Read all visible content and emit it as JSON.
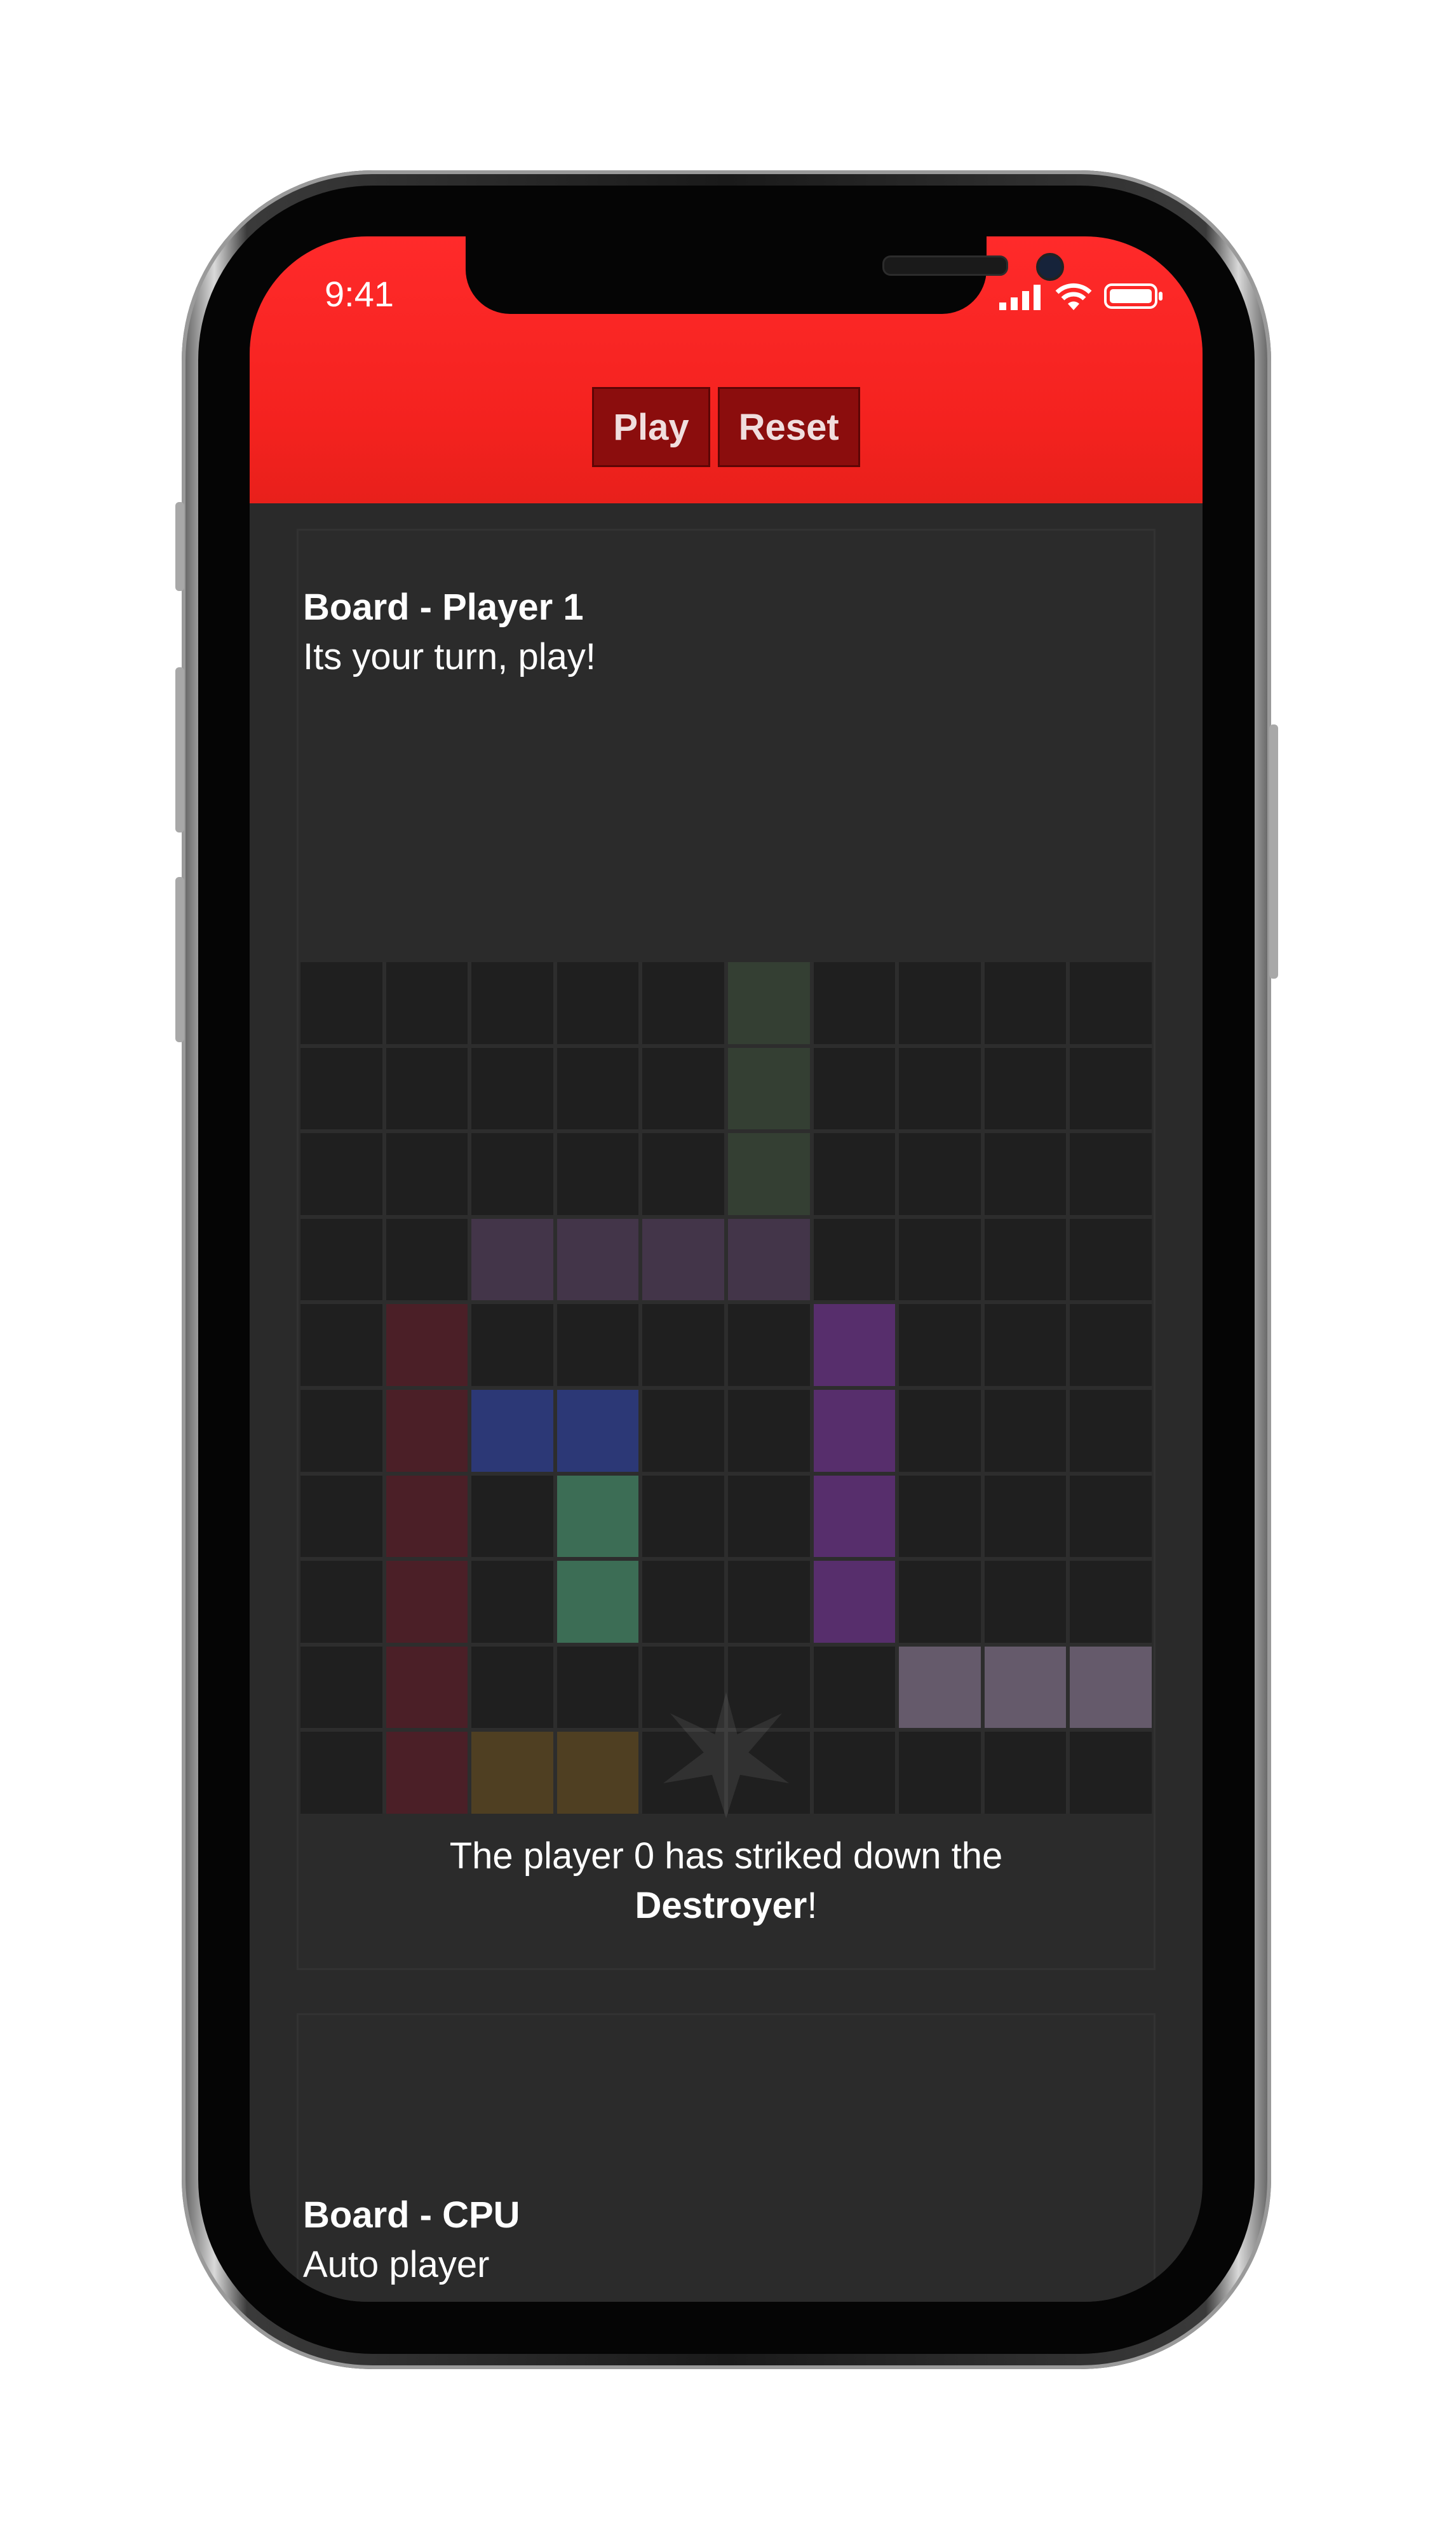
{
  "status_bar": {
    "time": "9:41"
  },
  "header": {
    "play_label": "Play",
    "reset_label": "Reset"
  },
  "player_board": {
    "title": "Board - Player 1",
    "subtitle": "Its your turn, play!",
    "rows": 10,
    "cols": 10,
    "ships": [
      {
        "color": "#343f33",
        "cells": [
          [
            0,
            5
          ],
          [
            1,
            5
          ],
          [
            2,
            5
          ]
        ]
      },
      {
        "color": "#433549",
        "cells": [
          [
            3,
            2
          ],
          [
            3,
            3
          ],
          [
            3,
            4
          ],
          [
            3,
            5
          ]
        ]
      },
      {
        "color": "#4b1f27",
        "cells": [
          [
            4,
            1
          ],
          [
            5,
            1
          ],
          [
            6,
            1
          ],
          [
            7,
            1
          ],
          [
            8,
            1
          ],
          [
            9,
            1
          ]
        ]
      },
      {
        "color": "#2c3876",
        "cells": [
          [
            5,
            2
          ],
          [
            5,
            3
          ]
        ]
      },
      {
        "color": "#3c6d55",
        "cells": [
          [
            6,
            3
          ],
          [
            7,
            3
          ]
        ]
      },
      {
        "color": "#572e6c",
        "cells": [
          [
            4,
            6
          ],
          [
            5,
            6
          ],
          [
            6,
            6
          ],
          [
            7,
            6
          ]
        ]
      },
      {
        "color": "#655a6b",
        "cells": [
          [
            8,
            7
          ],
          [
            8,
            8
          ],
          [
            8,
            9
          ]
        ]
      },
      {
        "color": "#4f3f22",
        "cells": [
          [
            9,
            2
          ],
          [
            9,
            3
          ]
        ]
      }
    ]
  },
  "notification": {
    "prefix": "The player 0 has striked down the",
    "ship": "Destroyer",
    "suffix": "!"
  },
  "cpu_board": {
    "title": "Board - CPU",
    "subtitle": "Auto player"
  }
}
